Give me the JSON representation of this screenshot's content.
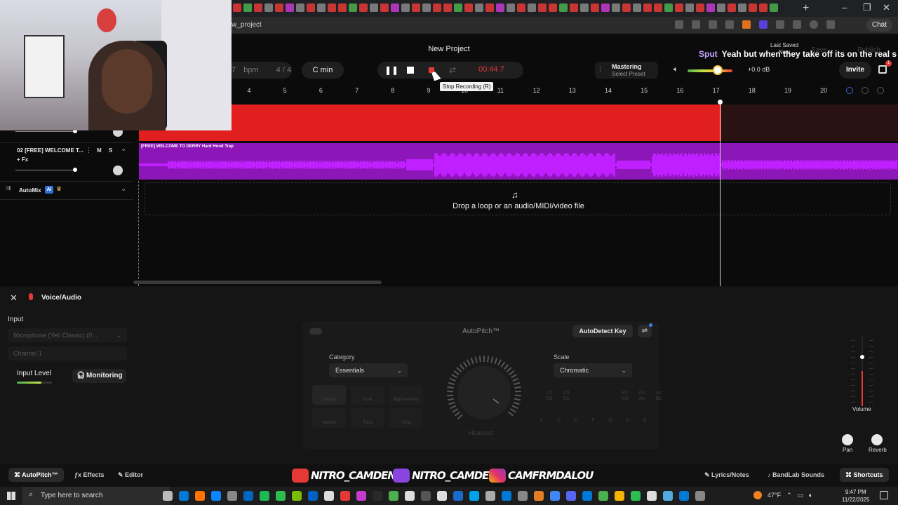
{
  "browser": {
    "url": "w_project",
    "chat_label": "Chat"
  },
  "header": {
    "project_title": "New Project",
    "bpm_value": "7",
    "bpm_unit": "bpm",
    "time_signature": "4 / 4",
    "key": "C min",
    "time_readout": "00:44.7",
    "tooltip": "Stop Recording (R)",
    "mastering_title": "Mastering",
    "mastering_sub": "Select Preset",
    "volume_db": "+0.0 dB",
    "last_saved_line1": "Last Saved",
    "last_saved_line2": "Now",
    "save_label": "Save",
    "publish_label": "Publish",
    "invite_label": "Invite",
    "cart_count": "1"
  },
  "chat_overlay": {
    "user": "Sput",
    "message": "Yeah but when they take off its on the real s"
  },
  "ruler": {
    "bars": [
      "4",
      "5",
      "6",
      "7",
      "8",
      "9",
      "10",
      "11",
      "12",
      "13",
      "14",
      "15",
      "16",
      "17",
      "18",
      "19",
      "20"
    ]
  },
  "tracks": {
    "track2_name": "02 [FREE] WELCOME T...",
    "track2_mute": "M",
    "track2_solo": "S",
    "fx_label": "+ Fx",
    "automix_label": "AutoMix",
    "ai_badge": "AI",
    "clip_label": "[FREE] WELCOME TO DERRY  Hard Hood Trap",
    "drop_text": "Drop a loop or an audio/MIDI/video file"
  },
  "panel": {
    "title": "Voice/Audio",
    "input_label": "Input",
    "input_device": "Microphone (Yeti Classic) (0...",
    "channel": "Channel 1",
    "input_level_label": "Input Level",
    "input_level": 0.7,
    "monitoring_label": "Monitoring"
  },
  "autopitch": {
    "title": "AutoPitch™",
    "autodetect_label": "AutoDetect Key",
    "category_label": "Category",
    "category_value": "Essentials",
    "scale_label": "Scale",
    "scale_value": "Chromatic",
    "presets": [
      "Classic",
      "Duet",
      "Big Harmony",
      "Natural",
      "Third",
      "Chip"
    ],
    "knob_label": "Heaviest",
    "chord_keys": [
      "C#\nDb",
      "D#\nEb",
      "F#\nGb",
      "G#\nAb",
      "A#\nBb"
    ],
    "note_keys": [
      "C",
      "D",
      "E",
      "F",
      "G",
      "A",
      "B"
    ]
  },
  "mixer": {
    "volume_label": "Volume",
    "volume_level": 0.63,
    "pan_label": "Pan",
    "reverb_label": "Reverb"
  },
  "bottom_tabs": {
    "autopitch": "AutoPitch™",
    "effects": "Effects",
    "editor": "Editor",
    "lyrics": "Lyrics/Notes",
    "bandlab_sounds": "BandLab Sounds",
    "shortcuts": "Shortcuts"
  },
  "socials": {
    "youtube": "NITRO_CAMDEN",
    "twitch": "NITRO_CAMDEN",
    "instagram": "CAMFRMDALOU"
  },
  "taskbar": {
    "search_placeholder": "Type here to search",
    "temperature": "47°F",
    "time": "9:47 PM",
    "date": "11/22/2025"
  },
  "colors": {
    "record_red": "#e53935",
    "clip_red": "#e21f1f",
    "clip_purple": "#8d16b8",
    "waveform": "#c020ff"
  }
}
